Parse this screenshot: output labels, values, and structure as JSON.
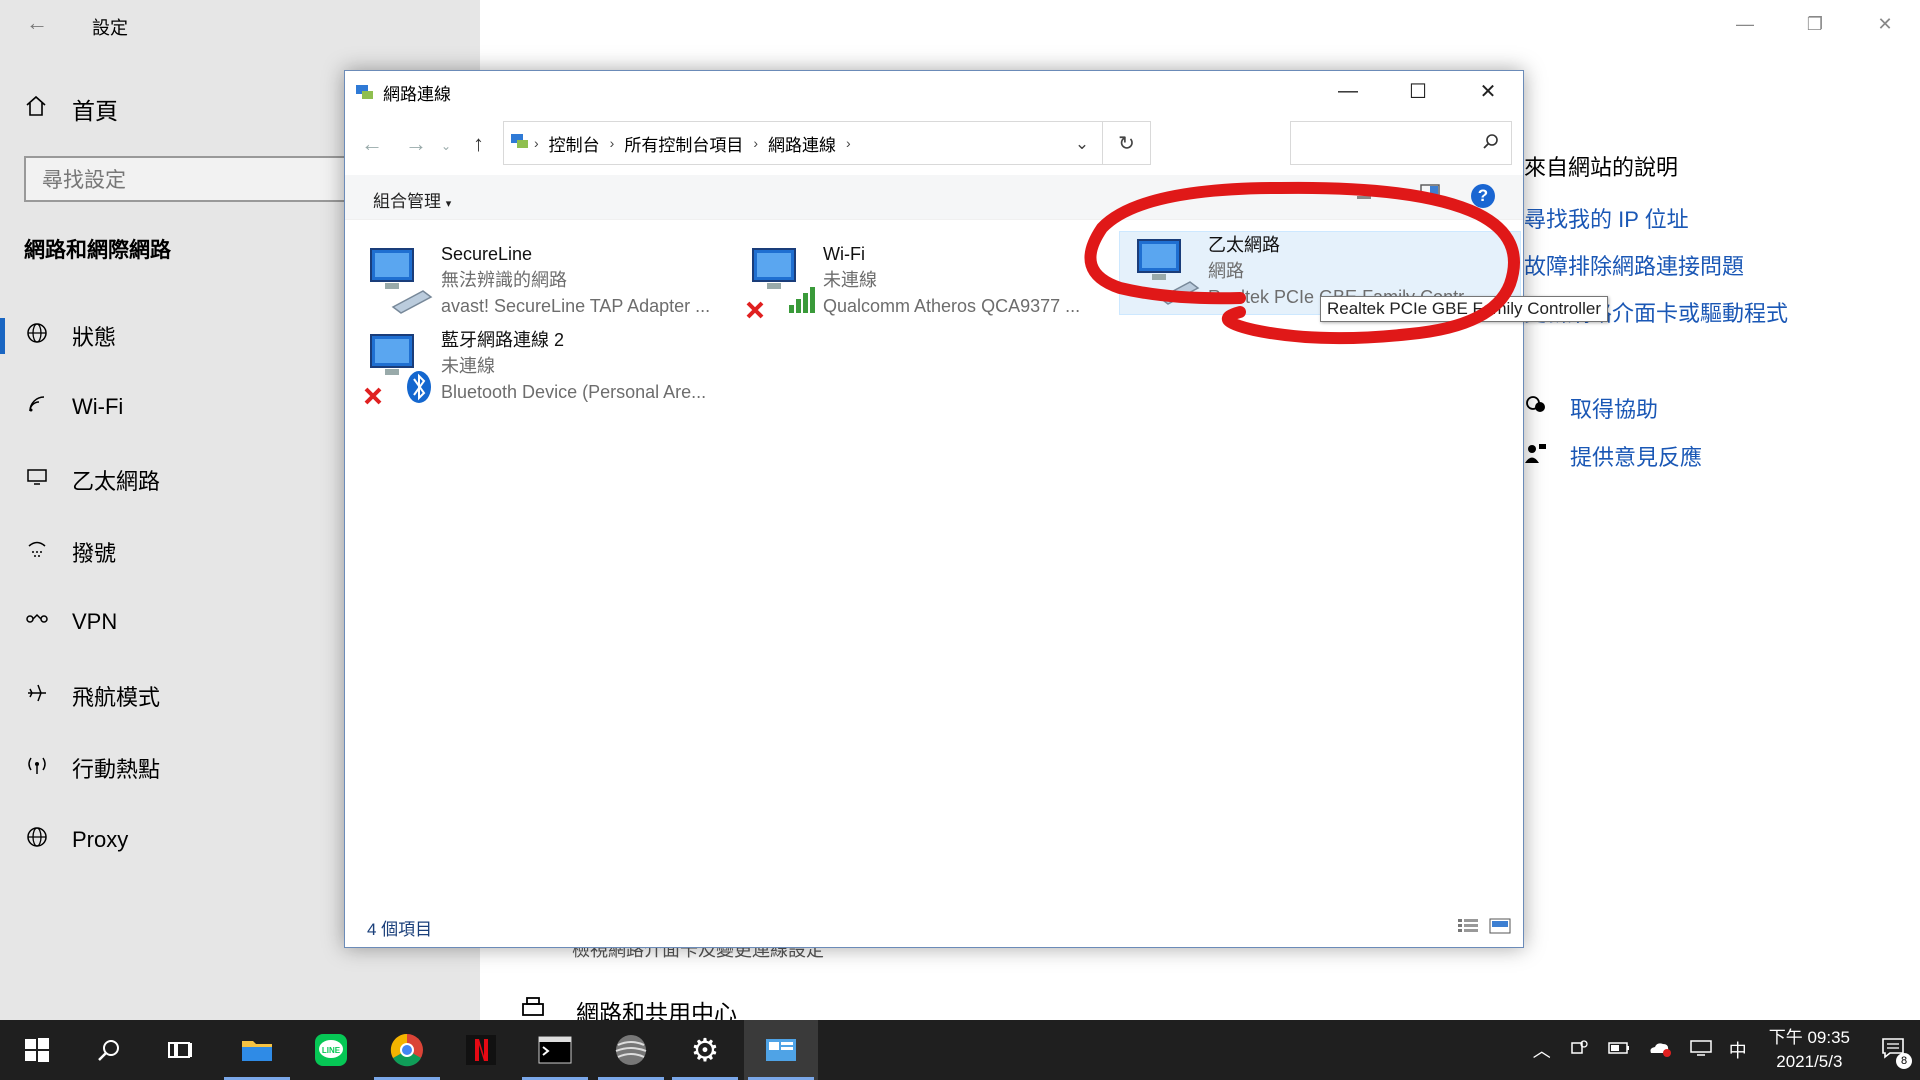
{
  "settings": {
    "title": "設定",
    "home": "首頁",
    "search_placeholder": "尋找設定",
    "group_title": "網路和網際網路",
    "nav": [
      {
        "label": "狀態",
        "icon": "globe-icon"
      },
      {
        "label": "Wi-Fi",
        "icon": "wifi-icon"
      },
      {
        "label": "乙太網路",
        "icon": "ethernet-icon"
      },
      {
        "label": "撥號",
        "icon": "dialup-icon"
      },
      {
        "label": "VPN",
        "icon": "vpn-icon"
      },
      {
        "label": "飛航模式",
        "icon": "airplane-icon"
      },
      {
        "label": "行動熱點",
        "icon": "hotspot-icon"
      },
      {
        "label": "Proxy",
        "icon": "globe-icon"
      }
    ],
    "help": {
      "title": "來自網站的說明",
      "links": [
        "尋找我的 IP 位址",
        "故障排除網路連接問題",
        "更新網路介面卡或驅動程式"
      ],
      "get_help": "取得協助",
      "feedback": "提供意見反應"
    },
    "bottom_text": "檢視網路介面卡及變更連線設定",
    "bottom_link": "網路和共用中心"
  },
  "explorer": {
    "title": "網路連線",
    "breadcrumb": [
      "控制台",
      "所有控制台項目",
      "網路連線"
    ],
    "organize": "組合管理",
    "connections": [
      {
        "name": "SecureLine",
        "status": "無法辨識的網路",
        "device": "avast! SecureLine TAP Adapter ..."
      },
      {
        "name": "Wi-Fi",
        "status": "未連線",
        "device": "Qualcomm Atheros QCA9377 ..."
      },
      {
        "name": "乙太網路",
        "status": "網路",
        "device": "Realtek PCIe GBE Family Contr..."
      },
      {
        "name": "藍牙網路連線 2",
        "status": "未連線",
        "device": "Bluetooth Device (Personal Are..."
      }
    ],
    "tooltip": "Realtek PCIe GBE Family Controller",
    "item_count": "4 個項目"
  },
  "taskbar": {
    "time": "下午 09:35",
    "date": "2021/5/3",
    "ime": "中",
    "notification_count": "8"
  },
  "colors": {
    "accent": "#1a66c2",
    "link": "#1a57b5",
    "annotation": "#e01818"
  }
}
